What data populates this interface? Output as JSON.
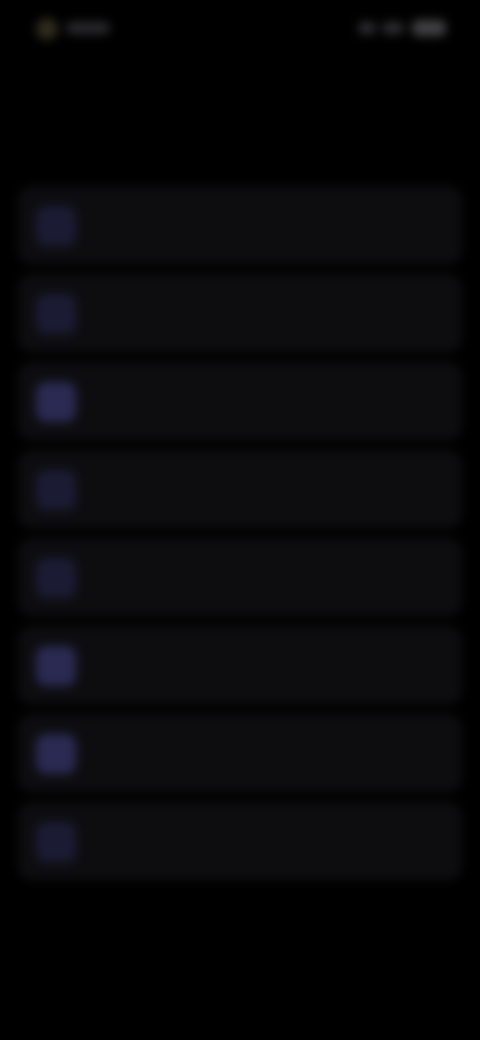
{
  "status_bar": {
    "left_indicator_icon": "status-dot-icon",
    "right_icons": [
      "signal-icon",
      "wifi-icon",
      "battery-icon"
    ]
  },
  "title": {
    "line1": "",
    "line2": ""
  },
  "list": {
    "items": [
      {
        "icon": "item-icon",
        "label": ""
      },
      {
        "icon": "item-icon",
        "label": ""
      },
      {
        "icon": "item-icon",
        "label": ""
      },
      {
        "icon": "item-icon",
        "label": ""
      },
      {
        "icon": "item-icon",
        "label": ""
      },
      {
        "icon": "item-icon",
        "label": ""
      },
      {
        "icon": "item-icon",
        "label": ""
      },
      {
        "icon": "item-icon",
        "label": ""
      }
    ]
  },
  "colors": {
    "background": "#000000",
    "card": "#0d0d10",
    "icon_tint": "#1b1b34"
  }
}
